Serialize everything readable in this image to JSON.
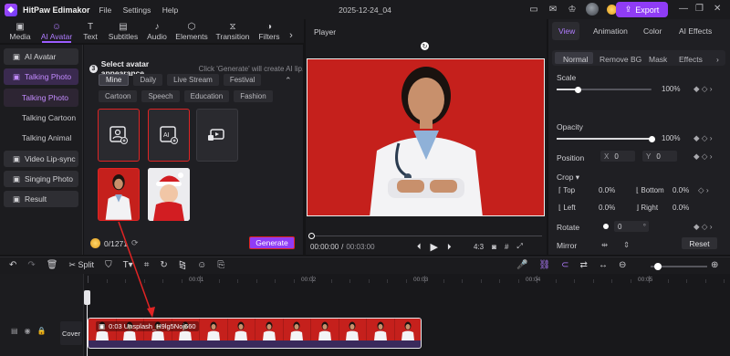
{
  "app": {
    "name": "HitPaw Edimakor",
    "menu": [
      "File",
      "Settings",
      "Help"
    ],
    "doc_title": "2025-12-24_04",
    "credits": "1271",
    "export_label": "Export"
  },
  "top_tabs": [
    {
      "label": "Media",
      "icon": "media-icon"
    },
    {
      "label": "AI Avatar",
      "icon": "ai-avatar-icon"
    },
    {
      "label": "Text",
      "icon": "text-icon"
    },
    {
      "label": "Subtitles",
      "icon": "subtitles-icon"
    },
    {
      "label": "Audio",
      "icon": "audio-icon"
    },
    {
      "label": "Elements",
      "icon": "elements-icon"
    },
    {
      "label": "Transition",
      "icon": "transition-icon"
    },
    {
      "label": "Filters",
      "icon": "filters-icon"
    }
  ],
  "sidebar": {
    "items": [
      "AI Avatar",
      "Talking Photo",
      "Video Lip-sync",
      "Singing Photo",
      "Result"
    ],
    "sub_items": [
      "Talking Photo",
      "Talking Cartoon",
      "Talking Animal"
    ]
  },
  "content": {
    "step_number": "3",
    "step_title": "Select avatar appearance",
    "step_hint": "Click 'Generate' will create AI lip...",
    "chips": [
      "Mine",
      "Daily",
      "Live Stream",
      "Festival",
      "Cartoon",
      "Speech",
      "Education",
      "Fashion"
    ],
    "credits_used": "0/1271",
    "generate_label": "Generate"
  },
  "player": {
    "title": "Player",
    "time_current": "00:00:00",
    "time_total": "00:03:00",
    "ratio": "4:3"
  },
  "props": {
    "tabs": [
      "View",
      "Animation",
      "Color",
      "AI Effects"
    ],
    "subtabs": [
      "Normal",
      "Remove BG",
      "Mask",
      "Effects"
    ],
    "scale_label": "Scale",
    "scale_value": "100%",
    "opacity_label": "Opacity",
    "opacity_value": "100%",
    "position_label": "Position",
    "pos_x_label": "X",
    "pos_x": "0",
    "pos_y_label": "Y",
    "pos_y": "0",
    "crop_label": "Crop",
    "crop_top_label": "Top",
    "crop_top": "0.0%",
    "crop_bottom_label": "Bottom",
    "crop_bottom": "0.0%",
    "crop_left_label": "Left",
    "crop_left": "0.0%",
    "crop_right_label": "Right",
    "crop_right": "0.0%",
    "rotate_label": "Rotate",
    "rotate_value": "0",
    "mirror_label": "Mirror",
    "reset_label": "Reset",
    "scale_level": 1.0,
    "opacity_level": 1.0
  },
  "toolbar": {
    "split_label": "Split"
  },
  "timeline": {
    "ruler": [
      "00:00",
      "00:01",
      "00:02",
      "00:03",
      "00:04",
      "00:05"
    ],
    "cover_label": "Cover",
    "clip_label": "0:03  Unsplash_H9lg5Noj660",
    "playhead_value": "00:00"
  },
  "colors": {
    "accent": "#8f3cf5",
    "selection": "#e02424",
    "photo_bg": "#c5201c",
    "clip": "#3a2a5c"
  }
}
